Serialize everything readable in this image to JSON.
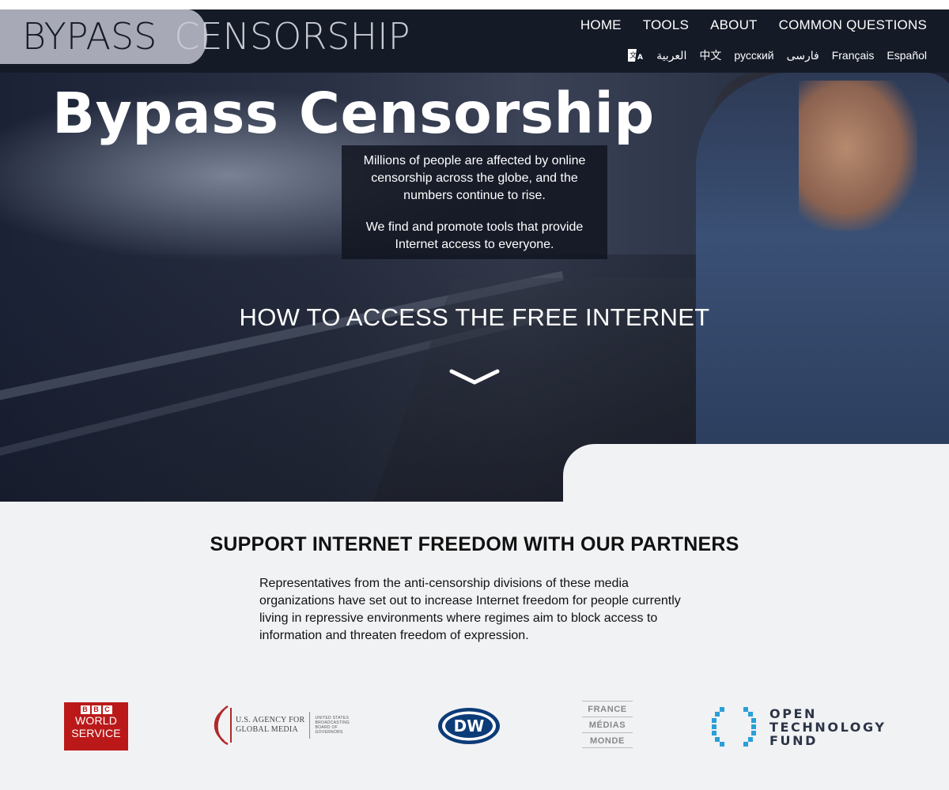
{
  "site": {
    "logo_word1": "BYPASS",
    "logo_word2": "CENSORSHIP"
  },
  "nav": {
    "items": [
      "HOME",
      "TOOLS",
      "ABOUT",
      "COMMON QUESTIONS"
    ]
  },
  "languages": {
    "icon": "translate-icon",
    "items": [
      "العربية",
      "中文",
      "русский",
      "فارسی",
      "Français",
      "Español"
    ]
  },
  "hero": {
    "title": "Bypass Censorship",
    "intro_p1": "Millions of people are affected by online censorship across the globe, and the numbers continue to rise.",
    "intro_p2": "We find and promote tools that provide Internet access to everyone.",
    "cta": "HOW TO ACCESS THE FREE INTERNET",
    "scroll_icon": "chevron-down-icon"
  },
  "partners": {
    "title": "SUPPORT INTERNET FREEDOM WITH OUR PARTNERS",
    "description": "Representatives from the anti-censorship divisions of these media organizations have set out to increase Internet freedom for people currently living in repressive environments where regimes aim to block access to information and threaten freedom of expression.",
    "bbc": {
      "blocks": [
        "B",
        "B",
        "C"
      ],
      "line1": "WORLD",
      "line2": "SERVICE"
    },
    "usagm": {
      "line1": "U.S. AGENCY FOR",
      "line2": "GLOBAL MEDIA",
      "small1": "UNITED STATES",
      "small2": "BROADCASTING",
      "small3": "BOARD OF",
      "small4": "GOVERNORS"
    },
    "dw": {
      "text": "DW"
    },
    "fmm": {
      "line1": "FRANCE",
      "line2": "MÉDIAS",
      "line3": "MONDE"
    },
    "otf": {
      "line1": "OPEN",
      "line2": "TECHNOLOGY",
      "line3": "FUND"
    }
  },
  "colors": {
    "header_bg": "#141a26",
    "logo_tab": "#a7a9b7",
    "page_bg": "#f1f2f4",
    "bbc_red": "#bb1919",
    "dw_blue": "#0c3c78",
    "otf_blue": "#2a9fd8"
  }
}
